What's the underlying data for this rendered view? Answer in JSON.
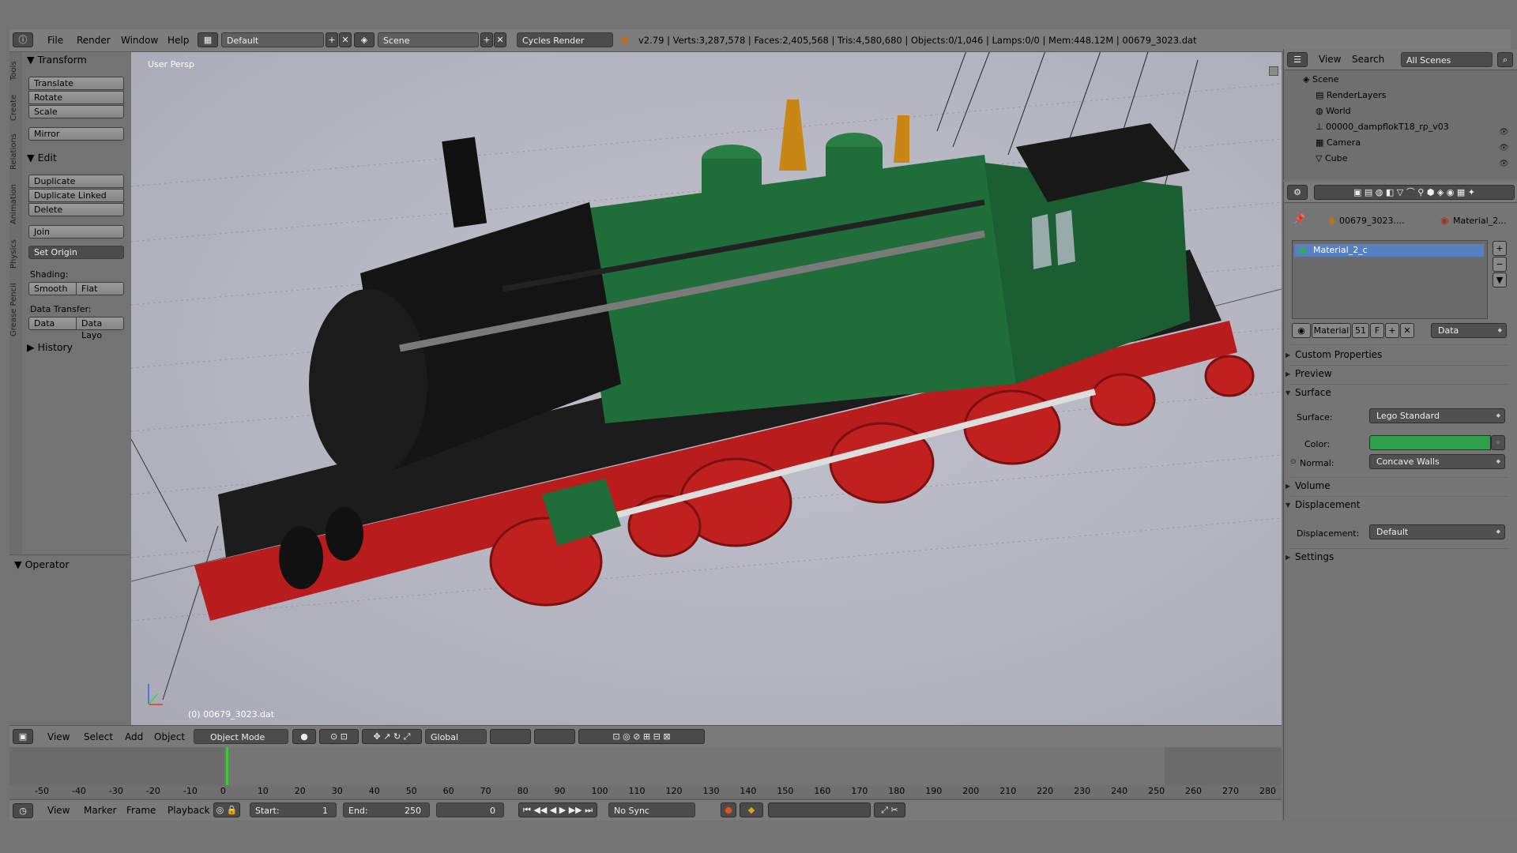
{
  "top_bar": {
    "menus": [
      "File",
      "Render",
      "Window",
      "Help"
    ],
    "screen_layout": "Default",
    "scene": "Scene",
    "render_engine": "Cycles Render",
    "stats": "v2.79 | Verts:3,287,578 | Faces:2,405,568 | Tris:4,580,680 | Objects:0/1,046 | Lamps:0/0 | Mem:448.12M | 00679_3023.dat"
  },
  "tool_tabs": [
    "Tools",
    "Create",
    "Relations",
    "Animation",
    "Physics",
    "Grease Pencil"
  ],
  "toolshelf": {
    "transform_header": "Transform",
    "transform_buttons": [
      "Translate",
      "Rotate",
      "Scale"
    ],
    "mirror": "Mirror",
    "edit_header": "Edit",
    "edit_buttons": [
      "Duplicate",
      "Duplicate Linked",
      "Delete"
    ],
    "join": "Join",
    "set_origin": "Set Origin",
    "shading_label": "Shading:",
    "smooth": "Smooth",
    "flat": "Flat",
    "data_transfer_label": "Data Transfer:",
    "data": "Data",
    "data_layout": "Data Layo",
    "history_header": "History",
    "operator_header": "Operator"
  },
  "viewport": {
    "view_name": "User Persp",
    "object_label": "(0) 00679_3023.dat"
  },
  "view3d_header": {
    "menus": [
      "View",
      "Select",
      "Add",
      "Object"
    ],
    "mode": "Object Mode",
    "orientation": "Global"
  },
  "timeline": {
    "ticks": [
      "-50",
      "-40",
      "-30",
      "-20",
      "-10",
      "0",
      "10",
      "20",
      "30",
      "40",
      "50",
      "60",
      "70",
      "80",
      "90",
      "100",
      "110",
      "120",
      "130",
      "140",
      "150",
      "160",
      "170",
      "180",
      "190",
      "200",
      "210",
      "220",
      "230",
      "240",
      "250",
      "260",
      "270",
      "280"
    ],
    "current_frame": 0,
    "menus": [
      "View",
      "Marker",
      "Frame",
      "Playback"
    ],
    "start_label": "Start:",
    "start_value": "1",
    "end_label": "End:",
    "end_value": "250",
    "frame_value": "0",
    "sync": "No Sync"
  },
  "outliner": {
    "menus": [
      "View",
      "Search"
    ],
    "scenes_select": "All Scenes",
    "items": [
      "Scene",
      "RenderLayers",
      "World",
      "00000_dampflokT18_rp_v03",
      "Camera",
      "Cube"
    ]
  },
  "properties": {
    "breadcrumb_object": "00679_3023....",
    "breadcrumb_material": "Material_2...",
    "material_slot": "Material_2_c",
    "material_name": "Material",
    "material_users": "51",
    "fake_user": "F",
    "link": "Data",
    "sections": {
      "custom_properties": "Custom Properties",
      "preview": "Preview",
      "surface": "Surface",
      "volume": "Volume",
      "displacement": "Displacement",
      "settings": "Settings"
    },
    "surface_label": "Surface:",
    "surface_value": "Lego Standard",
    "color_label": "Color:",
    "color_value": "#2e9e4a",
    "normal_label": "Normal:",
    "normal_value": "Concave Walls",
    "displacement_label": "Displacement:",
    "displacement_value": "Default"
  }
}
